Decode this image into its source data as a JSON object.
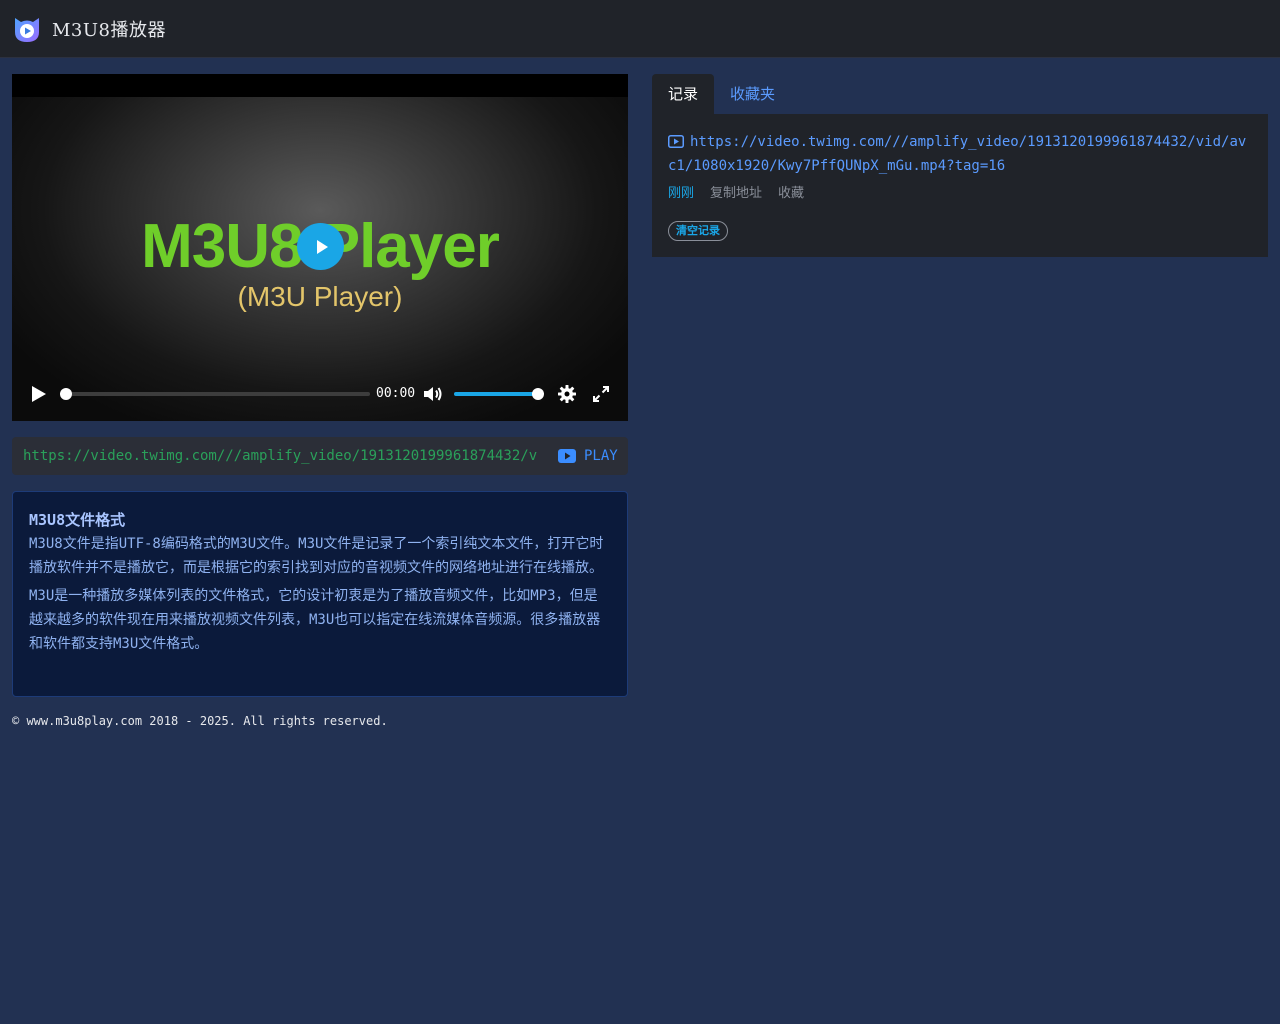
{
  "app": {
    "title": "M3U8播放器"
  },
  "player": {
    "poster_title": "M3U8 Player",
    "poster_subtitle": "(M3U Player)",
    "time": "00:00",
    "progress": 0,
    "volume": 1.0
  },
  "urlbar": {
    "value": "https://video.twimg.com///amplify_video/1913120199961874432/vid/avc1/1080x1920/Kwy7PffQUNpX_mGu.mp4?tag=16",
    "play_label": "PLAY"
  },
  "info": {
    "heading": "M3U8文件格式",
    "para1": "M3U8文件是指UTF-8编码格式的M3U文件。M3U文件是记录了一个索引纯文本文件，打开它时播放软件并不是播放它，而是根据它的索引找到对应的音视频文件的网络地址进行在线播放。",
    "para2": "M3U是一种播放多媒体列表的文件格式，它的设计初衷是为了播放音频文件，比如MP3，但是越来越多的软件现在用来播放视频文件列表，M3U也可以指定在线流媒体音频源。很多播放器和软件都支持M3U文件格式。"
  },
  "footer": {
    "text": "© www.m3u8play.com 2018 - 2025. All rights reserved."
  },
  "tabs": [
    {
      "label": "记录"
    },
    {
      "label": "收藏夹"
    }
  ],
  "history": {
    "url": "https://video.twimg.com///amplify_video/1913120199961874432/vid/avc1/1080x1920/Kwy7PffQUNpX_mGu.mp4?tag=16",
    "time": "刚刚",
    "copy_label": "复制地址",
    "fav_label": "收藏",
    "clear_label": "清空记录"
  },
  "colors": {
    "background": "#223152",
    "header": "#202329",
    "accent": "#1aa6e6",
    "link": "#5b9bff",
    "poster_green": "#6fce2a",
    "poster_gold": "#e3c56a"
  }
}
